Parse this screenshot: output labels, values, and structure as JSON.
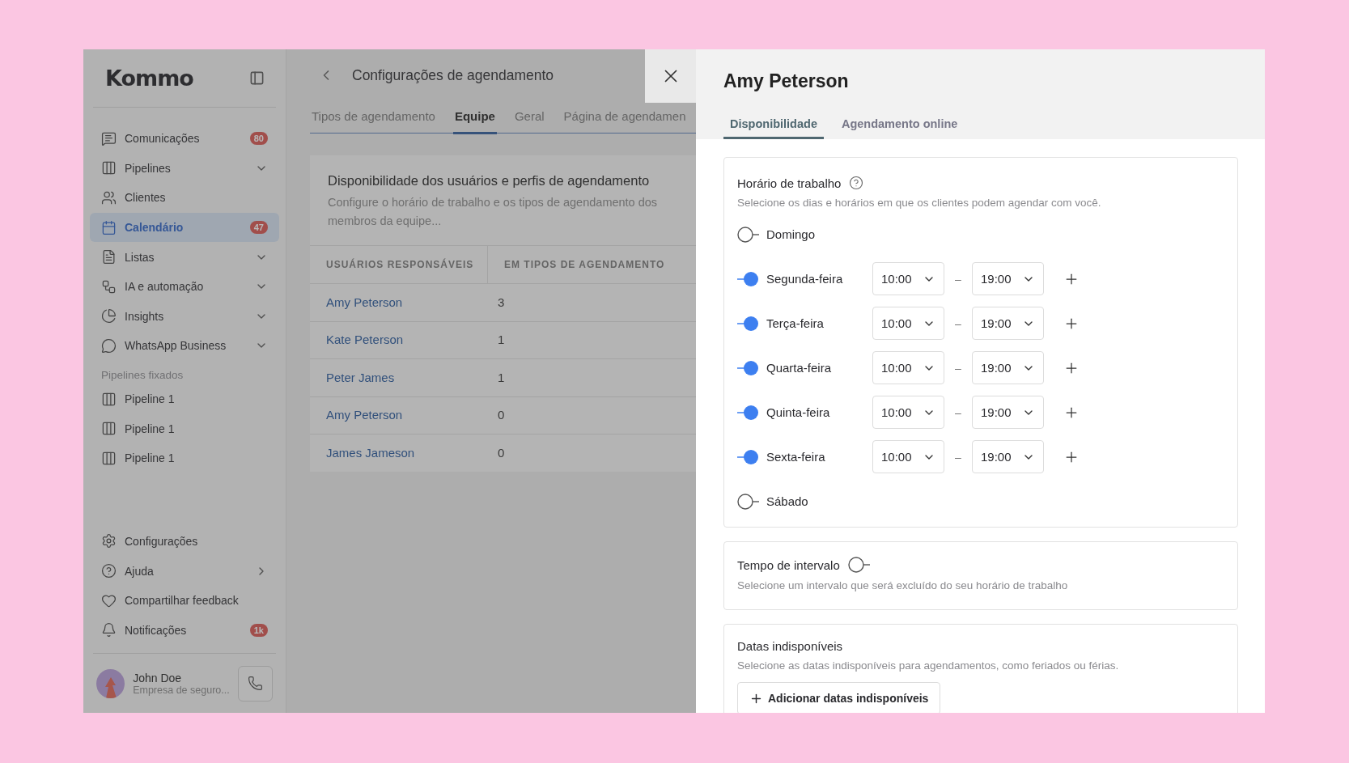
{
  "sidebar": {
    "logo": "Kommo",
    "items": [
      {
        "label": "Comunicações",
        "badge": "80",
        "expandable": false,
        "selected": false
      },
      {
        "label": "Pipelines",
        "expandable": true,
        "selected": false
      },
      {
        "label": "Clientes",
        "expandable": false,
        "selected": false
      },
      {
        "label": "Calendário",
        "badge": "47",
        "expandable": false,
        "selected": true
      },
      {
        "label": "Listas",
        "expandable": true,
        "selected": false
      },
      {
        "label": "IA e automação",
        "expandable": true,
        "selected": false
      },
      {
        "label": "Insights",
        "expandable": true,
        "selected": false
      },
      {
        "label": "WhatsApp Business",
        "expandable": true,
        "selected": false
      }
    ],
    "pinned_title": "Pipelines fixados",
    "pinned": [
      {
        "label": "Pipeline 1"
      },
      {
        "label": "Pipeline 1"
      },
      {
        "label": "Pipeline 1"
      }
    ],
    "bottom_items": [
      {
        "label": "Configurações",
        "submenu": false
      },
      {
        "label": "Ajuda",
        "submenu": true
      },
      {
        "label": "Compartilhar feedback",
        "submenu": false
      },
      {
        "label": "Notificações",
        "badge": "1k",
        "submenu": false
      }
    ],
    "user": {
      "name": "John Doe",
      "company": "Empresa de seguro..."
    }
  },
  "main": {
    "title": "Configurações de agendamento",
    "tabs": [
      {
        "label": "Tipos de agendamento",
        "selected": false
      },
      {
        "label": "Equipe",
        "selected": true
      },
      {
        "label": "Geral",
        "selected": false
      },
      {
        "label": "Página de agendamen",
        "selected": false
      }
    ],
    "card_title": "Disponibilidade dos usuários e perfis de agendamento",
    "card_description": "Configure o horário de trabalho e os tipos de agendamento dos membros da equipe...",
    "table": {
      "columns": [
        "USUÁRIOS RESPONSÁVEIS",
        "EM TIPOS DE AGENDAMENTO"
      ],
      "rows": [
        [
          "Amy Peterson",
          "3"
        ],
        [
          "Kate Peterson",
          "1"
        ],
        [
          "Peter James",
          "1"
        ],
        [
          "Amy Peterson",
          "0"
        ],
        [
          "James Jameson",
          "0"
        ]
      ]
    }
  },
  "panel": {
    "title": "Amy Peterson",
    "tabs": [
      {
        "label": "Disponibilidade",
        "selected": true
      },
      {
        "label": "Agendamento online",
        "selected": false
      }
    ],
    "work_hours": {
      "title": "Horário de trabalho",
      "description": "Selecione os dias e horários em que os clientes podem agendar com você.",
      "days": [
        {
          "name": "Domingo",
          "on": false
        },
        {
          "name": "Segunda-feira",
          "on": true,
          "start": "10:00",
          "separator": "–",
          "end": "19:00"
        },
        {
          "name": "Terça-feira",
          "on": true,
          "start": "10:00",
          "separator": "–",
          "end": "19:00"
        },
        {
          "name": "Quarta-feira",
          "on": true,
          "start": "10:00",
          "separator": "–",
          "end": "19:00"
        },
        {
          "name": "Quinta-feira",
          "on": true,
          "start": "10:00",
          "separator": "–",
          "end": "19:00"
        },
        {
          "name": "Sexta-feira",
          "on": true,
          "start": "10:00",
          "separator": "–",
          "end": "19:00"
        },
        {
          "name": "Sábado",
          "on": false
        }
      ]
    },
    "break": {
      "title": "Tempo de intervalo",
      "on": false,
      "description": "Selecione um intervalo que será excluído do seu horário de trabalho"
    },
    "unavailable": {
      "title": "Datas indisponíveis",
      "description": "Selecione as datas indisponíveis para agendamentos, como feriados ou férias.",
      "button": "Adicionar datas indisponíveis"
    }
  }
}
